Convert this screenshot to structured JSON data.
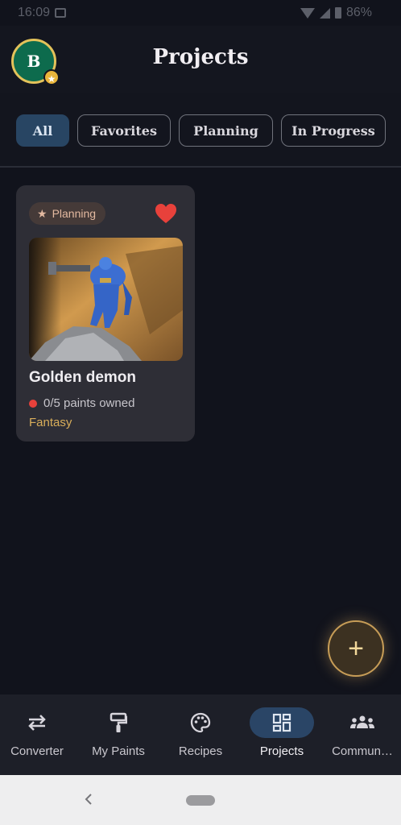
{
  "status_bar": {
    "time": "16:09",
    "battery": "86%"
  },
  "header": {
    "avatar_initial": "B",
    "title": "Projects"
  },
  "filters": [
    {
      "label": "All",
      "active": true
    },
    {
      "label": "Favorites",
      "active": false
    },
    {
      "label": "Planning",
      "active": false
    },
    {
      "label": "In Progress",
      "active": false
    }
  ],
  "project": {
    "status": "Planning",
    "favorite": true,
    "title": "Golden demon",
    "paints": "0/5 paints owned",
    "genre": "Fantasy"
  },
  "fab": {
    "icon": "plus-icon",
    "label": "+"
  },
  "nav": [
    {
      "label": "Converter",
      "icon": "swap-arrows-icon",
      "active": false
    },
    {
      "label": "My Paints",
      "icon": "paint-roller-icon",
      "active": false
    },
    {
      "label": "Recipes",
      "icon": "palette-icon",
      "active": false
    },
    {
      "label": "Projects",
      "icon": "dashboard-icon",
      "active": true
    },
    {
      "label": "Commun…",
      "icon": "community-icon",
      "active": false
    }
  ],
  "colors": {
    "background": "#11131c",
    "accent_active": "#2a4566",
    "favorite_heart": "#e8413b",
    "genre_gold": "#d9ae5a",
    "fab_border": "#c79d57"
  }
}
